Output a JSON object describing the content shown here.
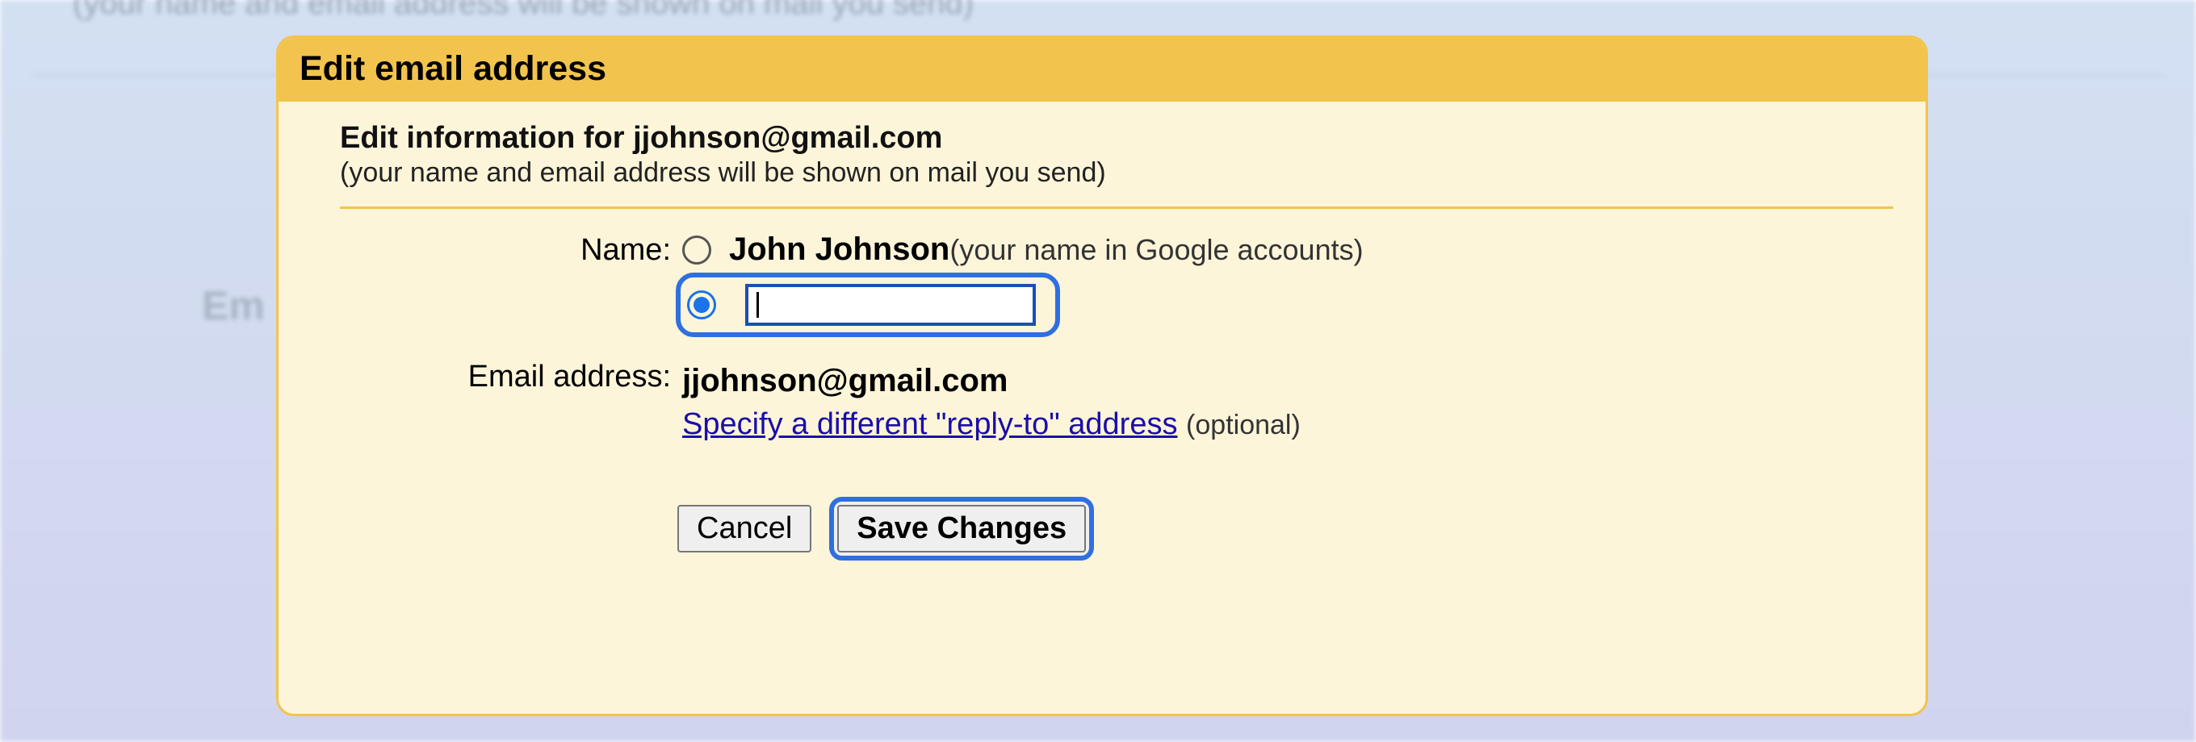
{
  "background": {
    "hint_line": "(your name and email address will be shown on mail you send)",
    "left_label": "Em"
  },
  "dialog": {
    "title": "Edit email address",
    "info_heading_prefix": "Edit information for ",
    "info_email": "jjohnson@gmail.com",
    "info_sub": "(your name and email address will be shown on mail you send)",
    "name_label": "Name:",
    "default_name": "John Johnson",
    "default_name_hint": "(your name in Google accounts)",
    "custom_name_value": "",
    "email_label": "Email address:",
    "email_value": "jjohnson@gmail.com",
    "reply_to_link": "Specify a different \"reply-to\" address",
    "reply_to_optional": "(optional)",
    "cancel": "Cancel",
    "save": "Save Changes",
    "name_radio_selected": "custom"
  }
}
